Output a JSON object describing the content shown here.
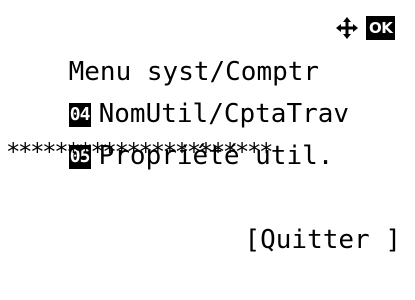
{
  "menu": {
    "title": "Menu syst/Comptr",
    "ok_label": "OK",
    "items": [
      {
        "number": "04",
        "label": "NomUtil/CptaTrav"
      },
      {
        "number": "05",
        "label": "Propriété util."
      }
    ],
    "separator": "**********************",
    "softkey_label": "[Quitter ]",
    "arrow_icon": "four-way-arrow-icon"
  },
  "colors": {
    "foreground": "#000000",
    "background": "#ffffff"
  }
}
